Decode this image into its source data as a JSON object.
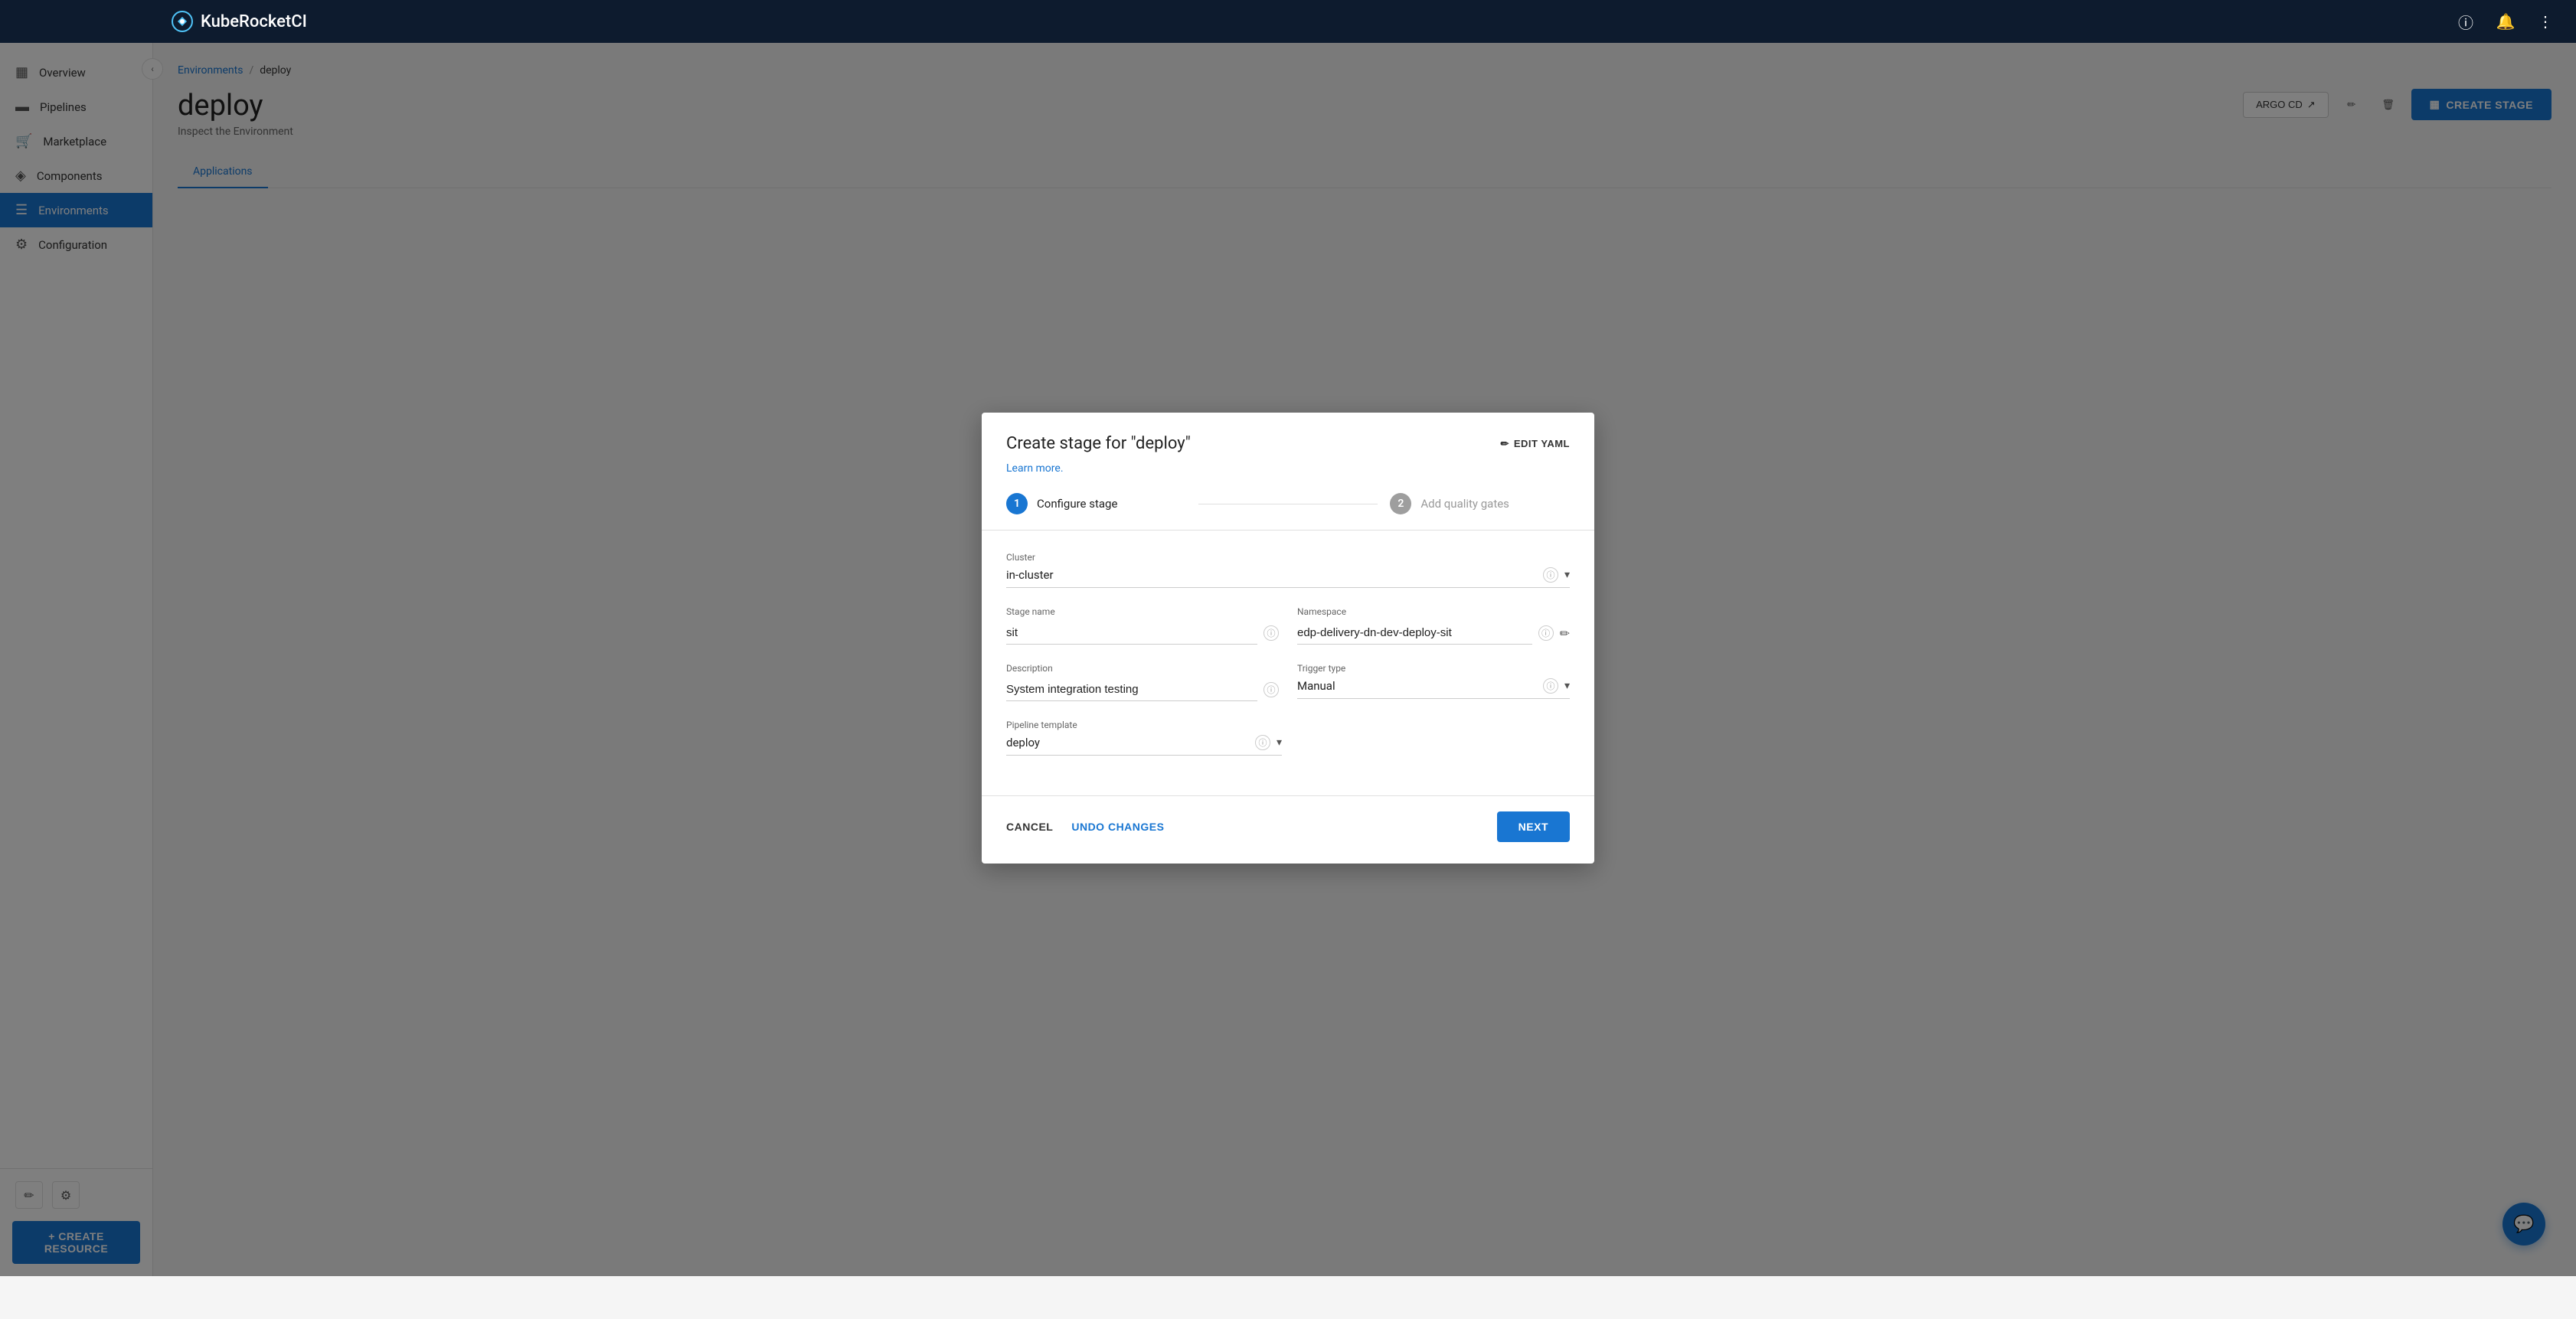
{
  "app": {
    "name": "KubeRocketCI"
  },
  "navbar": {
    "info_icon": "ℹ",
    "bell_icon": "🔔",
    "more_icon": "⋮"
  },
  "sidebar": {
    "items": [
      {
        "id": "overview",
        "label": "Overview",
        "icon": "▦"
      },
      {
        "id": "pipelines",
        "label": "Pipelines",
        "icon": "▬"
      },
      {
        "id": "marketplace",
        "label": "Marketplace",
        "icon": "🛒"
      },
      {
        "id": "components",
        "label": "Components",
        "icon": "◈"
      },
      {
        "id": "environments",
        "label": "Environments",
        "icon": "☰",
        "active": true
      },
      {
        "id": "configuration",
        "label": "Configuration",
        "icon": "⚙"
      }
    ],
    "create_resource_label": "+ CREATE RESOURCE",
    "bottom_icons": [
      "✏",
      "⚙"
    ]
  },
  "breadcrumb": {
    "link_label": "Environments",
    "separator": "/",
    "current": "deploy"
  },
  "page": {
    "title": "deploy",
    "subtitle": "Inspect the Environment",
    "tabs": [
      {
        "id": "applications",
        "label": "Applications"
      }
    ]
  },
  "page_actions": {
    "argo_cd_label": "ARGO CD",
    "edit_icon": "✏",
    "delete_icon": "🗑",
    "create_stage_label": "CREATE STAGE"
  },
  "dialog": {
    "title": "Create stage for \"deploy\"",
    "edit_yaml_label": "EDIT YAML",
    "learn_more_label": "Learn more.",
    "stepper": {
      "step1": {
        "number": "1",
        "label": "Configure stage",
        "active": true
      },
      "step2": {
        "number": "2",
        "label": "Add quality gates",
        "active": false
      }
    },
    "fields": {
      "cluster": {
        "label": "Cluster",
        "value": "in-cluster"
      },
      "stage_name": {
        "label": "Stage name",
        "value": "sit"
      },
      "namespace": {
        "label": "Namespace",
        "value": "edp-delivery-dn-dev-deploy-sit"
      },
      "description": {
        "label": "Description",
        "value": "System integration testing"
      },
      "trigger_type": {
        "label": "Trigger type",
        "value": "Manual"
      },
      "pipeline_template": {
        "label": "Pipeline template",
        "value": "deploy"
      }
    },
    "footer": {
      "cancel_label": "CANCEL",
      "undo_label": "UNDO CHANGES",
      "next_label": "NEXT"
    }
  },
  "fab": {
    "icon": "💬"
  }
}
